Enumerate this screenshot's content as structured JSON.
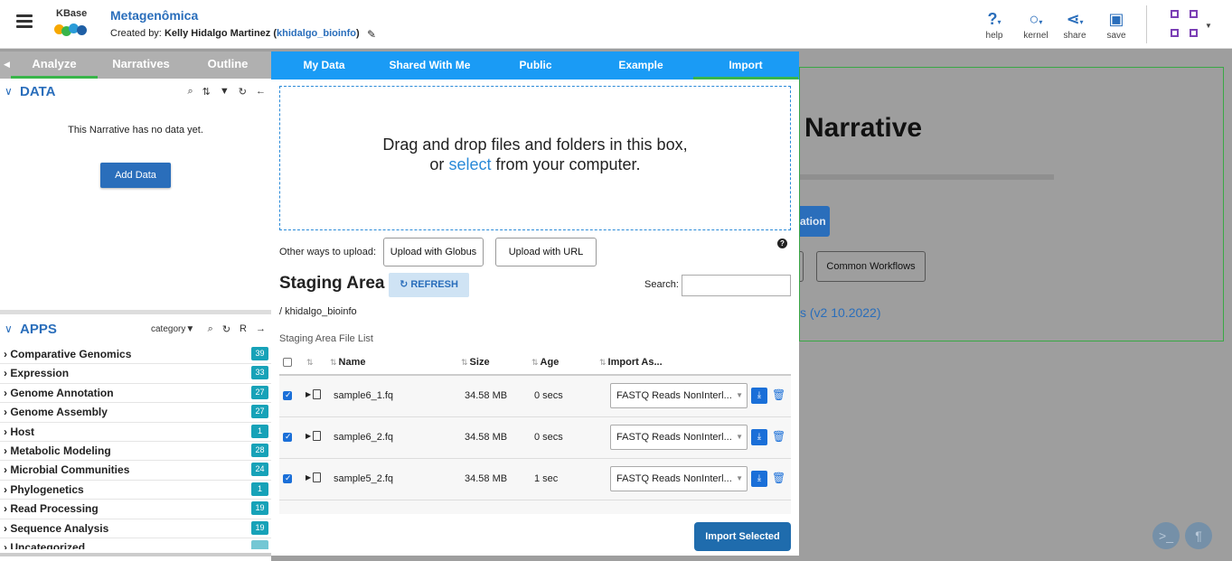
{
  "header": {
    "logo_text": "KBase",
    "title": "Metagenômica",
    "created_by_label": "Created by:",
    "creator_name": "Kelly Hidalgo Martinez",
    "creator_user": "khidalgo_bioinfo",
    "buttons": [
      {
        "icon": "help-icon",
        "label": "help"
      },
      {
        "icon": "kernel-icon",
        "label": "kernel"
      },
      {
        "icon": "share-icon",
        "label": "share"
      },
      {
        "icon": "save-icon",
        "label": "save"
      }
    ]
  },
  "left_panel": {
    "tabs": [
      "Analyze",
      "Narratives",
      "Outline"
    ],
    "active_tab": "Analyze",
    "data_section": {
      "title": "DATA",
      "empty_text": "This Narrative has no data yet.",
      "add_button": "Add Data"
    },
    "apps_section": {
      "title": "APPS",
      "category_label": "category",
      "r_label": "R",
      "categories": [
        {
          "name": "Comparative Genomics",
          "count": "39"
        },
        {
          "name": "Expression",
          "count": "33"
        },
        {
          "name": "Genome Annotation",
          "count": "27"
        },
        {
          "name": "Genome Assembly",
          "count": "27"
        },
        {
          "name": "Host",
          "count": "1"
        },
        {
          "name": "Metabolic Modeling",
          "count": "28"
        },
        {
          "name": "Microbial Communities",
          "count": "24"
        },
        {
          "name": "Phylogenetics",
          "count": "1"
        },
        {
          "name": "Read Processing",
          "count": "19"
        },
        {
          "name": "Sequence Analysis",
          "count": "19"
        },
        {
          "name": "Uncategorized",
          "count": ""
        }
      ]
    }
  },
  "import_panel": {
    "tabs": [
      "My Data",
      "Shared With Me",
      "Public",
      "Example",
      "Import"
    ],
    "active_tab": "Import",
    "dropzone_line1": "Drag and drop files and folders in this box,",
    "dropzone_or": "or",
    "dropzone_select": "select",
    "dropzone_rest": "from your computer.",
    "other_ways_label": "Other ways to upload:",
    "globus_button": "Upload with Globus",
    "url_button": "Upload with URL",
    "staging_title": "Staging Area",
    "refresh_button": "REFRESH",
    "search_label": "Search:",
    "search_value": "",
    "path": "/ khidalgo_bioinfo",
    "file_list_label": "Staging Area File List",
    "columns": [
      "Name",
      "Size",
      "Age",
      "Import As..."
    ],
    "files": [
      {
        "name": "sample6_1.fq",
        "size": "34.58 MB",
        "age": "0 secs",
        "import_as": "FASTQ Reads NonInterl...",
        "checked": true
      },
      {
        "name": "sample6_2.fq",
        "size": "34.58 MB",
        "age": "0 secs",
        "import_as": "FASTQ Reads NonInterl...",
        "checked": true
      },
      {
        "name": "sample5_2.fq",
        "size": "34.58 MB",
        "age": "1 sec",
        "import_as": "FASTQ Reads NonInterl...",
        "checked": true
      }
    ],
    "import_button": "Import Selected"
  },
  "background_narrative": {
    "title_fragment": "Narrative",
    "button_fragment": "ation",
    "common_workflows": "Common Workflows",
    "version_fragment": "s (v2 10.2022)"
  },
  "colors": {
    "brand_blue": "#2a6ebb",
    "tab_blue": "#1a9bf5",
    "active_green": "#39b54a",
    "badge_teal": "#17a2b8"
  }
}
